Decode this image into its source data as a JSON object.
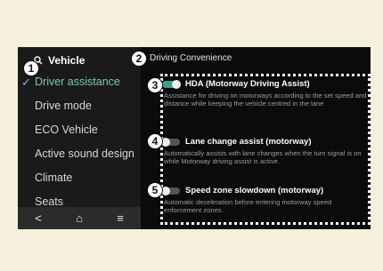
{
  "sidebar": {
    "title": "Vehicle",
    "search_icon": "search-icon",
    "items": [
      {
        "label": "Driver assistance",
        "active": true
      },
      {
        "label": "Drive mode"
      },
      {
        "label": "ECO Vehicle"
      },
      {
        "label": "Active sound design"
      },
      {
        "label": "Climate"
      },
      {
        "label": "Seats"
      }
    ],
    "nav": {
      "back": "<",
      "home": "⌂",
      "menu": "≡"
    }
  },
  "content": {
    "title": "Driving Convenience",
    "options": [
      {
        "title": "HDA (Motorway Driving Assist)",
        "enabled": true,
        "description": "Assistance for driving on motorways according to the set speed and distance while keeping the vehicle centred in the lane"
      },
      {
        "title": "Lane change assist (motorway)",
        "enabled": false,
        "description": "Automatically assists with lane changes when the turn signal is on while Motorway driving assist is active."
      },
      {
        "title": "Speed zone slowdown (motorway)",
        "enabled": false,
        "description": "Automatic deceleration before entering motorway speed enforcement zones."
      }
    ]
  },
  "callouts": [
    "1",
    "2",
    "3",
    "4",
    "5"
  ],
  "colors": {
    "accent": "#7cc8b4",
    "toggle_on": "#3c9c86",
    "frame": "#f5f0dc"
  }
}
